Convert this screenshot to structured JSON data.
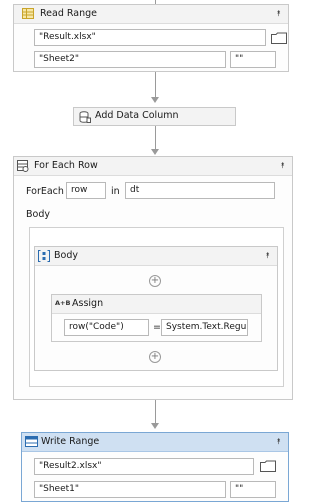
{
  "read_range": {
    "title": "Read Range",
    "workbook_path": "\"Result.xlsx\"",
    "sheet_name": "\"Sheet2\"",
    "range": "\"\""
  },
  "add_data_column": {
    "title": "Add Data Column"
  },
  "for_each_row": {
    "title": "For Each Row",
    "foreach_label": "ForEach",
    "item_var": "row",
    "in_label": "in",
    "collection": "dt",
    "body_label": "Body",
    "sequence": {
      "title": "Body",
      "assign": {
        "title": "Assign",
        "type_badge": "A+B",
        "to": "row(\"Code\")",
        "operator": "=",
        "value": "System.Text.Regula"
      }
    }
  },
  "write_range": {
    "title": "Write Range",
    "workbook_path": "\"Result2.xlsx\"",
    "sheet_name": "\"Sheet1\"",
    "range": "\"\""
  },
  "icons": {
    "collapse": "chevron-double-up",
    "browse": "folder-icon",
    "add": "plus-circle-icon"
  },
  "colors": {
    "selected_header": "#cfe0f2",
    "header": "#f3f3f3",
    "border": "#c9c9c9",
    "excel_icon": "#e6c34a"
  }
}
